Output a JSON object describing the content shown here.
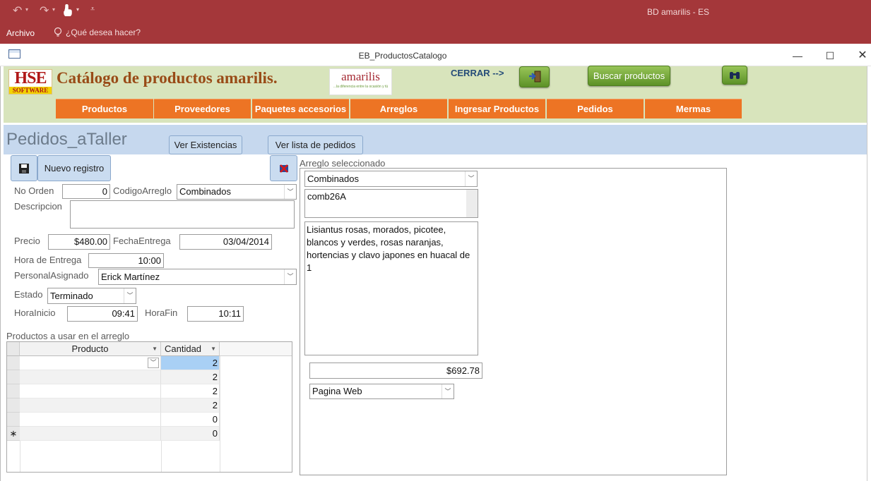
{
  "app": {
    "title": "BD amarilis - ES",
    "menu_archivo": "Archivo",
    "tell_me": "¿Qué desea hacer?"
  },
  "form": {
    "window_title": "EB_ProductosCatalogo"
  },
  "header": {
    "hse_logo_line1": "HSE",
    "hse_logo_line2": "SOFTWARE",
    "title": "Catálogo de productos amarilis.",
    "amarilis_logo": "amarilis",
    "amarilis_tagline": "...la diferencia entre la ocasión y tú",
    "cerrar_label": "CERRAR -->",
    "buscar_label": "Buscar productos",
    "tabs": [
      "Productos",
      "Proveedores",
      "Paquetes accesorios",
      "Arreglos",
      "Ingresar Productos",
      "Pedidos",
      "Mermas"
    ]
  },
  "section": {
    "title": "Pedidos_aTaller",
    "ver_existencias": "Ver Existencias",
    "ver_lista": "Ver lista de pedidos",
    "nuevo_registro": "Nuevo registro"
  },
  "fields": {
    "no_orden_label": "No Orden",
    "no_orden": "0",
    "codigo_arreglo_label": "CodigoArreglo",
    "codigo_arreglo": "Combinados",
    "descripcion_label": "Descripcion",
    "descripcion": "",
    "precio_label": "Precio",
    "precio": "$480.00",
    "fecha_entrega_label": "FechaEntrega",
    "fecha_entrega": "03/04/2014",
    "hora_entrega_label": "Hora de Entrega",
    "hora_entrega": "10:00",
    "personal_label": "PersonalAsignado",
    "personal": "Erick Martínez",
    "estado_label": "Estado",
    "estado": "Terminado",
    "hora_inicio_label": "HoraInicio",
    "hora_inicio": "09:41",
    "hora_fin_label": "HoraFin",
    "hora_fin": "10:11"
  },
  "subform": {
    "label": "Productos a usar en el arreglo",
    "col_producto": "Producto",
    "col_cantidad": "Cantidad",
    "new_row_marker": "∗",
    "rows": [
      {
        "producto": "",
        "cantidad": "2"
      },
      {
        "producto": "",
        "cantidad": "2"
      },
      {
        "producto": "",
        "cantidad": "2"
      },
      {
        "producto": "",
        "cantidad": "2"
      },
      {
        "producto": "",
        "cantidad": "0"
      },
      {
        "producto": "",
        "cantidad": "0"
      }
    ]
  },
  "arreglo": {
    "label": "Arreglo seleccionado",
    "categoria": "Combinados",
    "codigo": "comb26A",
    "descripcion": "Lisiantus rosas, morados, picotee, blancos y verdes, rosas naranjas, hortencias y clavo japones en huacal de 1",
    "precio": "$692.78",
    "canal": "Pagina Web"
  },
  "colors": {
    "app_bar": "#a4373a",
    "header_green": "#d8e4bc",
    "tab_orange": "#ed7424",
    "section_blue": "#c6d8ee"
  }
}
